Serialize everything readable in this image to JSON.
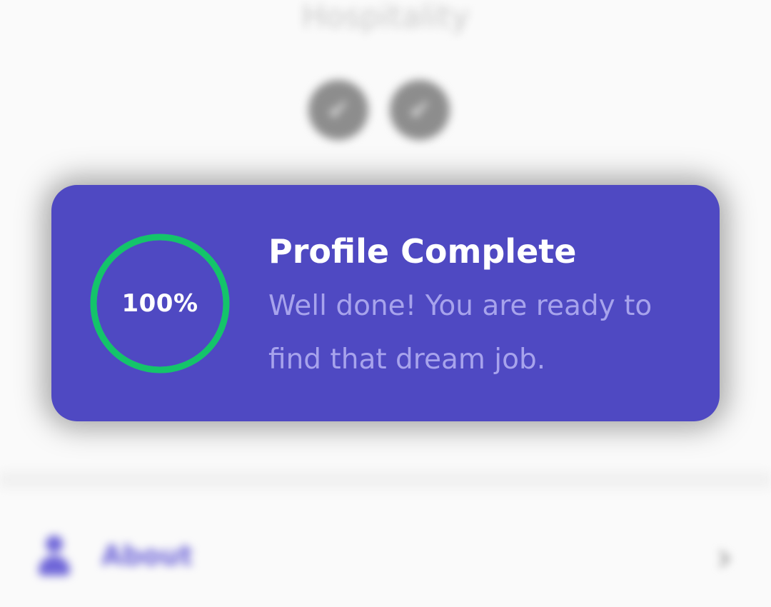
{
  "background": {
    "section_title": "Hospitality",
    "badges": [
      {
        "icon": "check-icon"
      },
      {
        "icon": "check-icon"
      }
    ],
    "row": {
      "icon": "person-icon",
      "label": "About",
      "chevron": "chevron-right-icon"
    }
  },
  "completion_card": {
    "progress_percent": 100,
    "progress_label": "100%",
    "title": "Profile Complete",
    "message": "Well done! You are ready to find that dream job.",
    "colors": {
      "card_background": "#4f49c2",
      "ring": "#14c46a",
      "title": "#ffffff",
      "message": "#a7a3ec"
    }
  }
}
